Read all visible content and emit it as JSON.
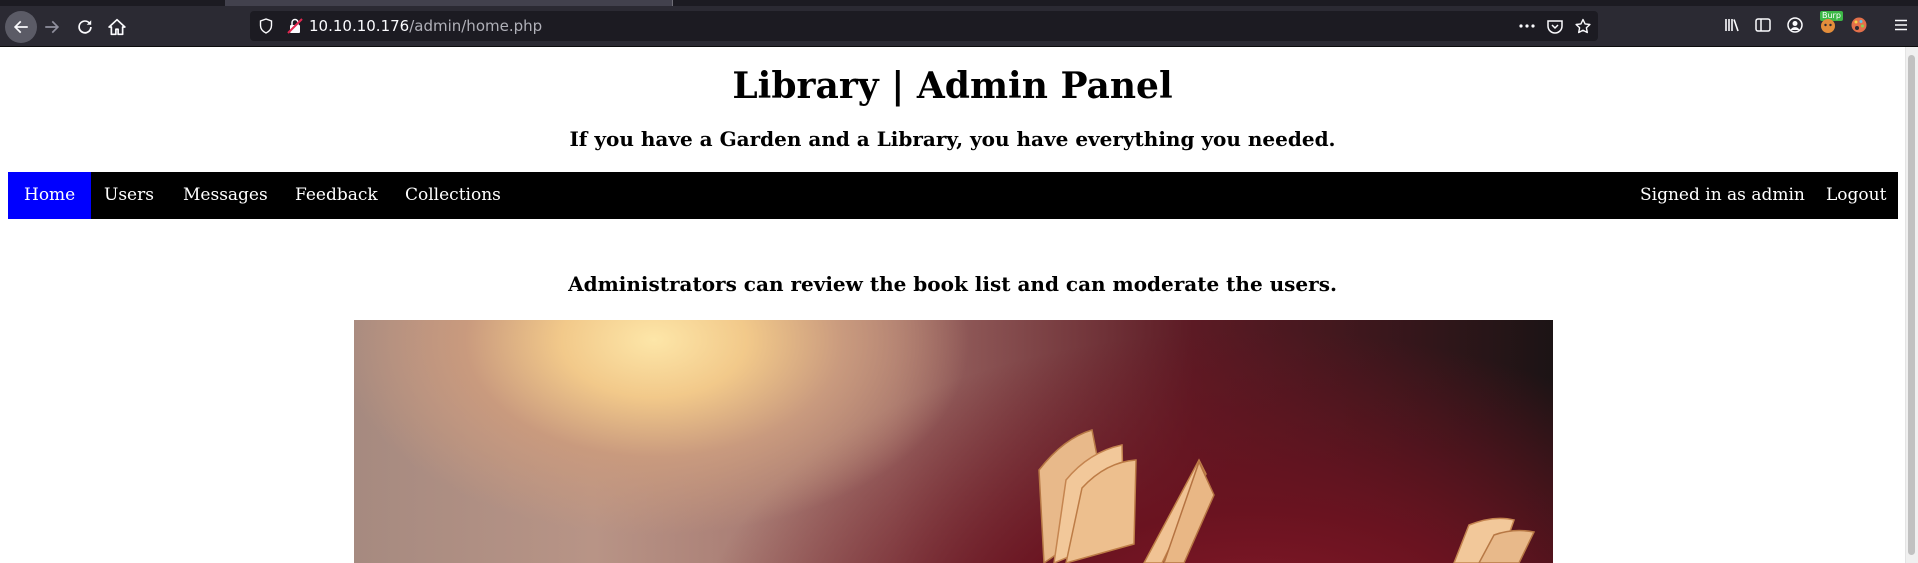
{
  "browser": {
    "url_host": "10.10.10.176",
    "url_path": "/admin/home.php",
    "burp_badge": "Burp"
  },
  "page": {
    "title": "Library | Admin Panel",
    "tagline": "If you have a Garden and a Library, you have everything you needed.",
    "intro": "Administrators can review the book list and can moderate the users."
  },
  "nav": {
    "items": [
      {
        "label": "Home",
        "active": true
      },
      {
        "label": "Users"
      },
      {
        "label": "Messages"
      },
      {
        "label": "Feedback"
      },
      {
        "label": "Collections"
      }
    ],
    "signed_in": "Signed in as admin",
    "logout": "Logout",
    "active_color": "#0000ff",
    "bar_color": "#000000"
  },
  "hero_image": {
    "icon": "open-books-photo"
  }
}
